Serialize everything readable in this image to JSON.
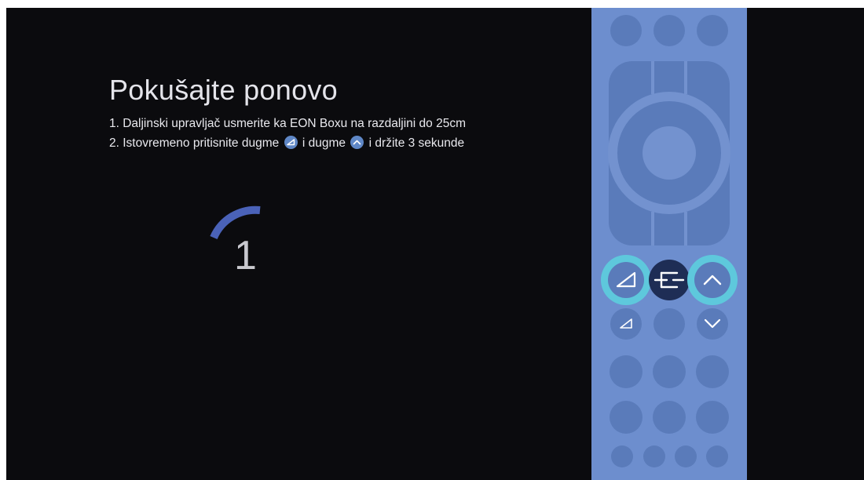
{
  "dialog": {
    "title": "Pokušajte ponovo",
    "step1": "1. Daljinski upravljač usmerite ka EON Boxu na razdaljini do 25cm",
    "step2_part1": "2. Istovremeno pritisnite dugme",
    "step2_part2": "i dugme",
    "step2_part3": "i držite 3 sekunde",
    "inline_icons": [
      "volume-triangle-icon",
      "chevron-up-icon"
    ]
  },
  "countdown": {
    "value": "1"
  },
  "remote": {
    "highlighted_buttons": [
      "volume-button",
      "channel-up-button"
    ],
    "center_icon": "menu-icon"
  },
  "colors": {
    "background": "#0b0b0e",
    "remote_body": "#6d8ece",
    "remote_button": "#5a7bba",
    "highlight_ring": "#5ec8dc",
    "progress_arc": "#4a62b8"
  }
}
